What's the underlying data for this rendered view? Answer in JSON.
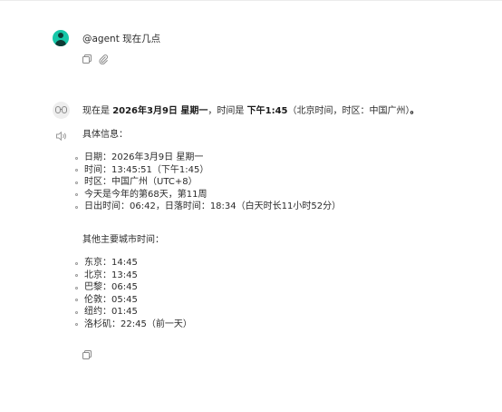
{
  "user": {
    "message": "@agent 现在几点"
  },
  "answer": {
    "prefix": "现在是 ",
    "date_bold": "2026年3月9日 星期一",
    "mid": "，时间是 ",
    "time_bold": "下午1:45",
    "suffix": "（北京时间，时区：中国广州）",
    "end_bold": "。"
  },
  "info": {
    "title": "具体信息：",
    "items": [
      "日期：2026年3月9日 星期一",
      "时间：13:45:51（下午1:45）",
      "时区：中国广州（UTC+8）",
      "今天是今年的第68天，第11周",
      "日出时间：06:42，日落时间：18:34（白天时长11小时52分）"
    ]
  },
  "cities": {
    "title": "其他主要城市时间：",
    "items": [
      "东京：14:45",
      "北京：13:45",
      "巴黎：06:45",
      "伦敦：05:45",
      "纽约：01:45",
      "洛杉矶：22:45（前一天）"
    ]
  },
  "icons": {
    "user_avatar": "user-avatar-icon",
    "bot_avatar": "bot-avatar-icon",
    "copy": "copy-icon",
    "attach": "paperclip-icon",
    "speaker": "speaker-icon"
  },
  "colors": {
    "user_avatar_bg": "#16c7a8",
    "bot_avatar_bg": "#eeeeee"
  }
}
